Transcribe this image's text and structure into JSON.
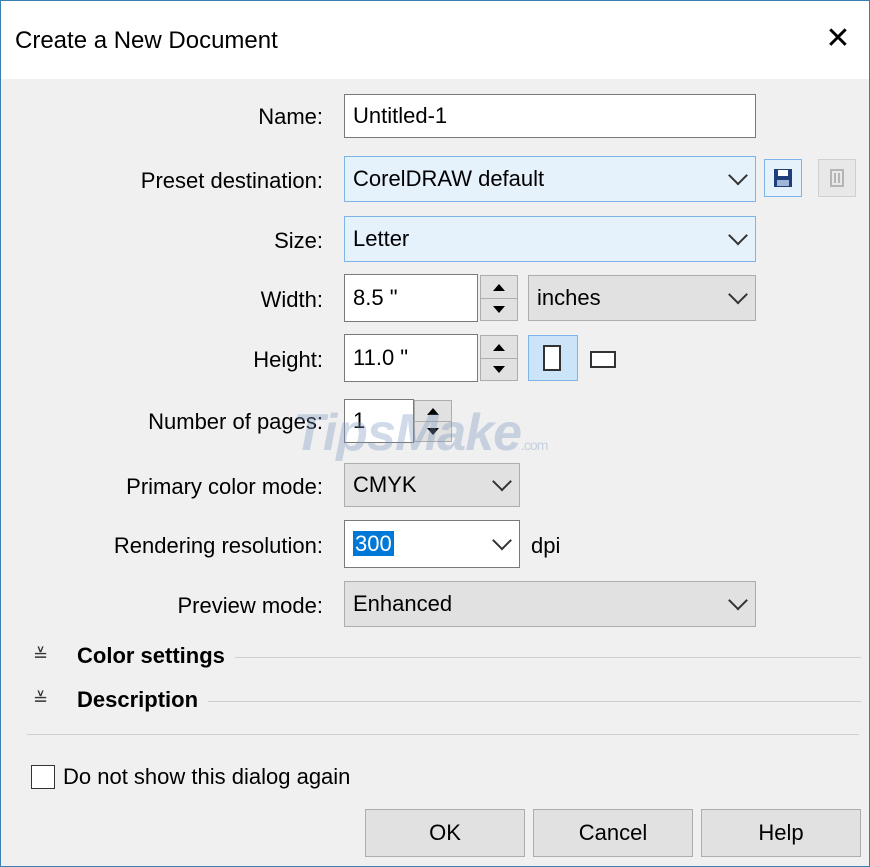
{
  "dialog": {
    "title": "Create a New Document",
    "close_glyph": "✕"
  },
  "form": {
    "name": {
      "label": "Name:",
      "value": "Untitled-1"
    },
    "preset": {
      "label": "Preset destination:",
      "value": "CorelDRAW default"
    },
    "size": {
      "label": "Size:",
      "value": "Letter"
    },
    "width": {
      "label": "Width:",
      "value": "8.5 \"",
      "unit": "inches"
    },
    "height": {
      "label": "Height:",
      "value": "11.0 \""
    },
    "pages": {
      "label": "Number of pages:",
      "value": "1"
    },
    "color_mode": {
      "label": "Primary color mode:",
      "value": "CMYK"
    },
    "resolution": {
      "label": "Rendering resolution:",
      "value": "300",
      "unit": "dpi"
    },
    "preview": {
      "label": "Preview mode:",
      "value": "Enhanced"
    }
  },
  "sections": {
    "color_settings": "Color settings",
    "description": "Description",
    "expand_glyph": "≚"
  },
  "footer": {
    "checkbox_label": "Do not show this dialog again",
    "ok": "OK",
    "cancel": "Cancel",
    "help": "Help"
  },
  "watermark": {
    "brand": "TipsMake",
    "suffix": ".com"
  },
  "colors": {
    "accent": "#0078d7",
    "combo_bg": "#e5f1fb",
    "window_border": "#3c7fb1"
  },
  "icons": [
    "close-icon",
    "save-preset-icon",
    "delete-preset-icon",
    "portrait-icon",
    "landscape-icon",
    "expand-icon",
    "chevron-down-icon"
  ]
}
